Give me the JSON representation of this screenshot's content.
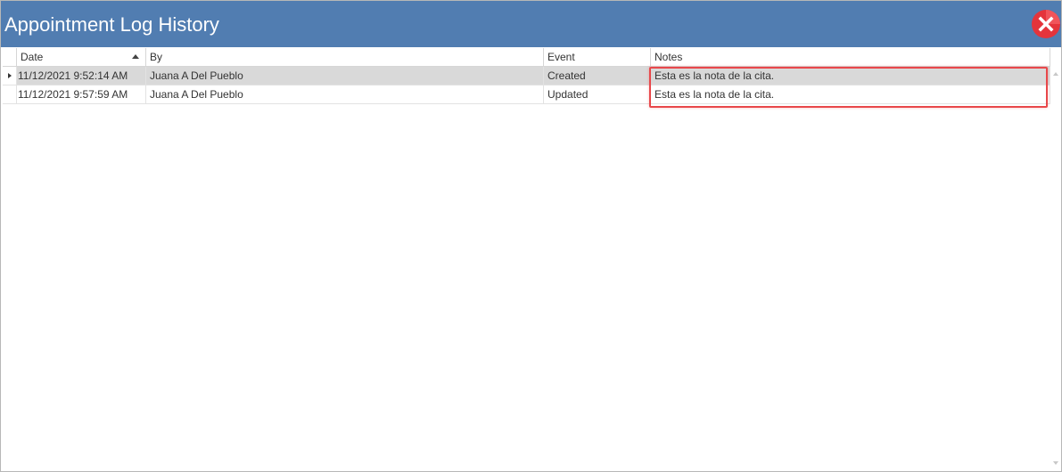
{
  "window": {
    "title": "Appointment Log History",
    "close_icon": "close-icon"
  },
  "grid": {
    "columns": [
      {
        "key": "date",
        "label": "Date",
        "sorted": "ascending"
      },
      {
        "key": "by",
        "label": "By"
      },
      {
        "key": "event",
        "label": "Event"
      },
      {
        "key": "notes",
        "label": "Notes"
      }
    ],
    "rows": [
      {
        "date": "11/12/2021 9:52:14 AM",
        "by": "Juana A Del Pueblo",
        "event": "Created",
        "notes": "Esta es la nota de la cita.",
        "selected": true
      },
      {
        "date": "11/12/2021 9:57:59 AM",
        "by": "Juana A Del Pueblo",
        "event": "Updated",
        "notes": "Esta es la nota de la cita.",
        "selected": false
      }
    ]
  },
  "colors": {
    "titlebar": "#517db1",
    "selected_row": "#d9d9d9",
    "highlight": "#e8474a",
    "close_button": "#e4343b"
  }
}
